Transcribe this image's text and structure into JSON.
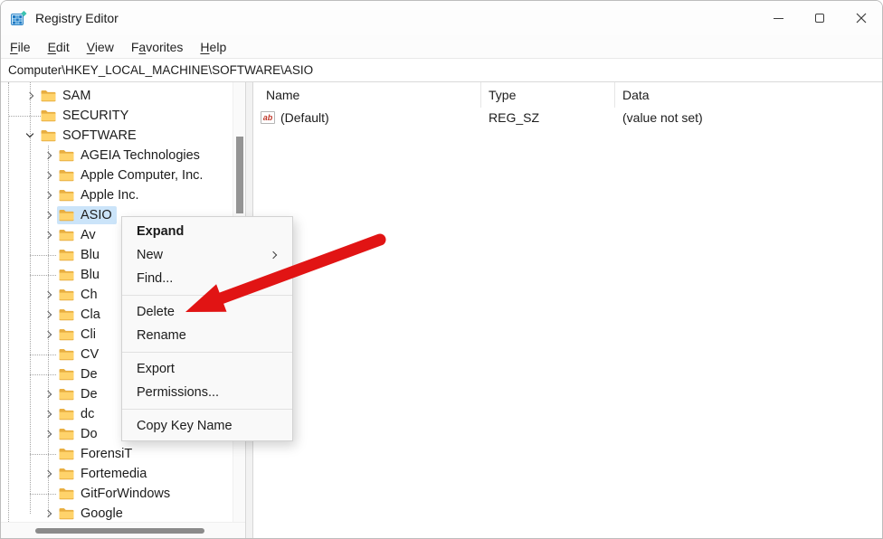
{
  "window": {
    "title": "Registry Editor"
  },
  "menubar": {
    "items": [
      {
        "label": "File",
        "accel": "F"
      },
      {
        "label": "Edit",
        "accel": "E"
      },
      {
        "label": "View",
        "accel": "V"
      },
      {
        "label": "Favorites",
        "accel": "a"
      },
      {
        "label": "Help",
        "accel": "H"
      }
    ]
  },
  "addressbar": {
    "value": "Computer\\HKEY_LOCAL_MACHINE\\SOFTWARE\\ASIO"
  },
  "tree": {
    "items": [
      {
        "label": "SAM",
        "level": 1,
        "chevron": "collapsed",
        "selected": false
      },
      {
        "label": "SECURITY",
        "level": 1,
        "chevron": "none",
        "selected": false
      },
      {
        "label": "SOFTWARE",
        "level": 1,
        "chevron": "expanded",
        "selected": false
      },
      {
        "label": "AGEIA Technologies",
        "level": 2,
        "chevron": "collapsed",
        "selected": false
      },
      {
        "label": "Apple Computer, Inc.",
        "level": 2,
        "chevron": "collapsed",
        "selected": false
      },
      {
        "label": "Apple Inc.",
        "level": 2,
        "chevron": "collapsed",
        "selected": false
      },
      {
        "label": "ASIO",
        "level": 2,
        "chevron": "collapsed",
        "selected": true
      },
      {
        "label": "Av",
        "level": 2,
        "chevron": "collapsed",
        "selected": false
      },
      {
        "label": "Blu",
        "level": 2,
        "chevron": "none",
        "selected": false
      },
      {
        "label": "Blu",
        "level": 2,
        "chevron": "none",
        "selected": false
      },
      {
        "label": "Ch",
        "level": 2,
        "chevron": "collapsed",
        "selected": false
      },
      {
        "label": "Cla",
        "level": 2,
        "chevron": "collapsed",
        "selected": false
      },
      {
        "label": "Cli",
        "level": 2,
        "chevron": "collapsed",
        "selected": false
      },
      {
        "label": "CV",
        "level": 2,
        "chevron": "none",
        "selected": false
      },
      {
        "label": "De",
        "level": 2,
        "chevron": "none",
        "selected": false
      },
      {
        "label": "De",
        "level": 2,
        "chevron": "collapsed",
        "selected": false
      },
      {
        "label": "dc",
        "level": 2,
        "chevron": "collapsed",
        "selected": false
      },
      {
        "label": "Do",
        "level": 2,
        "chevron": "collapsed",
        "selected": false
      },
      {
        "label": "ForensiT",
        "level": 2,
        "chevron": "none",
        "selected": false
      },
      {
        "label": "Fortemedia",
        "level": 2,
        "chevron": "collapsed",
        "selected": false
      },
      {
        "label": "GitForWindows",
        "level": 2,
        "chevron": "none",
        "selected": false
      },
      {
        "label": "Google",
        "level": 2,
        "chevron": "collapsed",
        "selected": false
      }
    ]
  },
  "listview": {
    "columns": [
      "Name",
      "Type",
      "Data"
    ],
    "rows": [
      {
        "name": "(Default)",
        "type": "REG_SZ",
        "data": "(value not set)",
        "icon": "string-value-icon"
      }
    ]
  },
  "context_menu": {
    "items": [
      {
        "type": "item",
        "label": "Expand",
        "bold": true,
        "submenu": false
      },
      {
        "type": "item",
        "label": "New",
        "bold": false,
        "submenu": true
      },
      {
        "type": "item",
        "label": "Find...",
        "bold": false,
        "submenu": false
      },
      {
        "type": "separator"
      },
      {
        "type": "item",
        "label": "Delete",
        "bold": false,
        "submenu": false
      },
      {
        "type": "item",
        "label": "Rename",
        "bold": false,
        "submenu": false
      },
      {
        "type": "separator"
      },
      {
        "type": "item",
        "label": "Export",
        "bold": false,
        "submenu": false
      },
      {
        "type": "item",
        "label": "Permissions...",
        "bold": false,
        "submenu": false
      },
      {
        "type": "separator"
      },
      {
        "type": "item",
        "label": "Copy Key Name",
        "bold": false,
        "submenu": false
      }
    ]
  },
  "icons": {
    "string_value_glyph": "ab"
  },
  "colors": {
    "selection": "#cbe4f9",
    "arrow": "#e11414",
    "folder_front": "#ffd36b",
    "folder_back": "#e8ae41",
    "app_icon_blue": "#1f7ac4",
    "app_icon_teal": "#3cc3b0"
  }
}
